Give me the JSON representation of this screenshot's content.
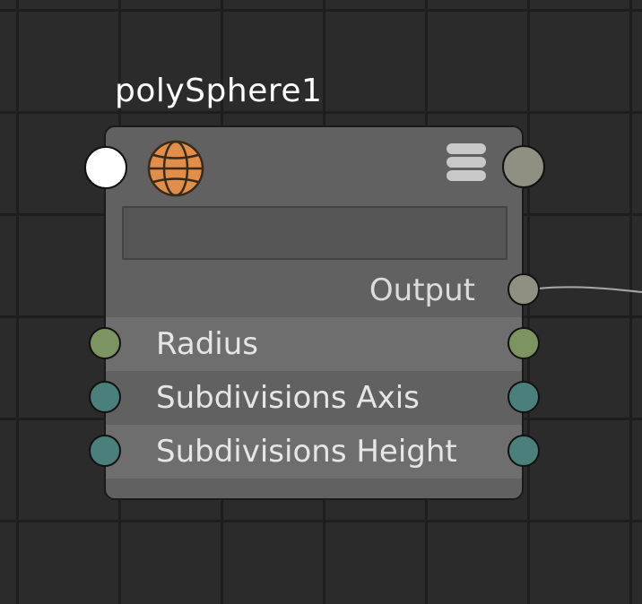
{
  "node": {
    "title": "polySphere1",
    "name_field_value": "",
    "output_label": "Output",
    "attributes": [
      {
        "label": "Radius",
        "port_color": "#7c9461"
      },
      {
        "label": "Subdivisions Axis",
        "port_color": "#4b7f7c"
      },
      {
        "label": "Subdivisions Height",
        "port_color": "#4b7f7c"
      }
    ]
  },
  "icons": {
    "node_type": "sphere-icon",
    "menu": "hamburger-menu-icon"
  },
  "colors": {
    "canvas_background": "#2b2b2b",
    "grid_line": "#1e1e1e",
    "node_body": "#616161",
    "sphere_icon": "#e08e4a",
    "input_message_port": "#ffffff",
    "output_message_port": "#8f8f82",
    "output_port": "#8f8f82",
    "wire": "#a8a8a8"
  }
}
